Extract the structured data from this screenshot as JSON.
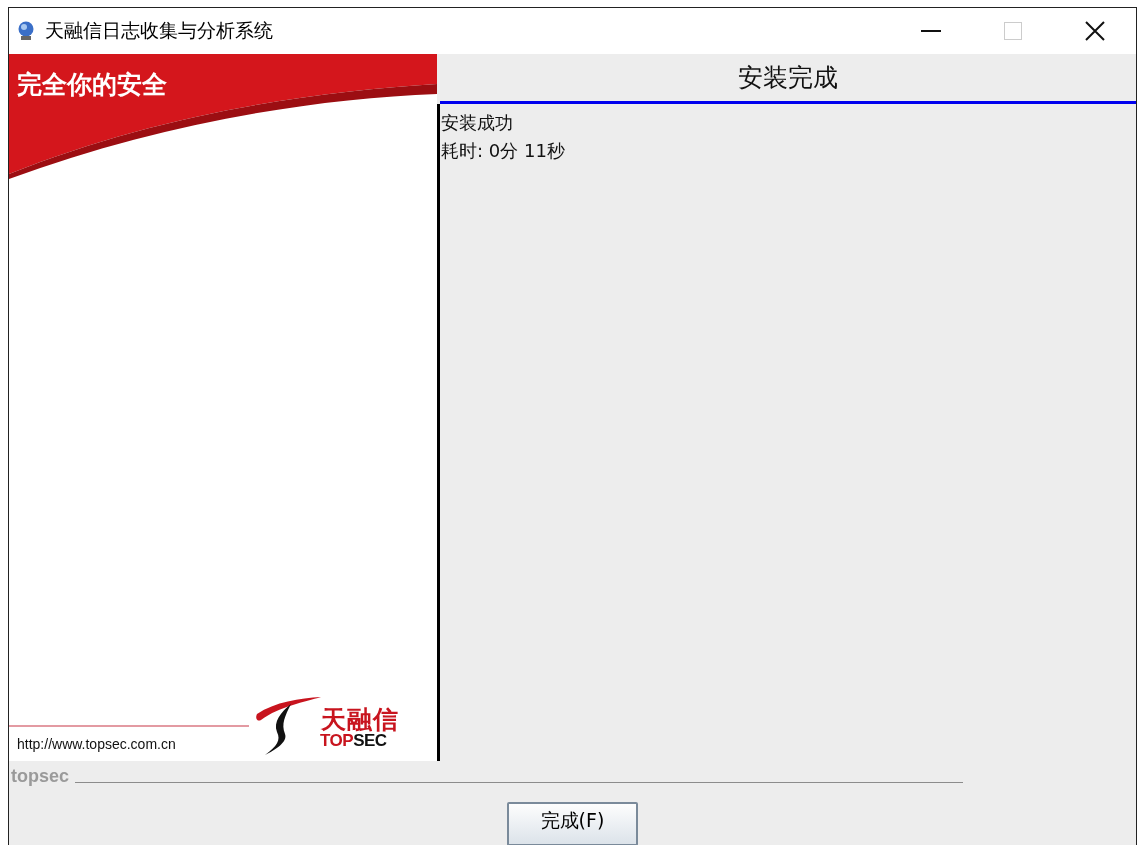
{
  "window": {
    "title": "天融信日志收集与分析系统"
  },
  "banner": {
    "slogan": "完全你的安全",
    "url": "http://www.topsec.com.cn",
    "logo_cn": "天融信",
    "logo_en_red": "TOP",
    "logo_en_dark": "SEC"
  },
  "page": {
    "heading": "安装完成",
    "lines": [
      "安装成功",
      "耗时: 0分 11秒"
    ]
  },
  "footer": {
    "brand": "topsec",
    "button": "完成(F)"
  }
}
